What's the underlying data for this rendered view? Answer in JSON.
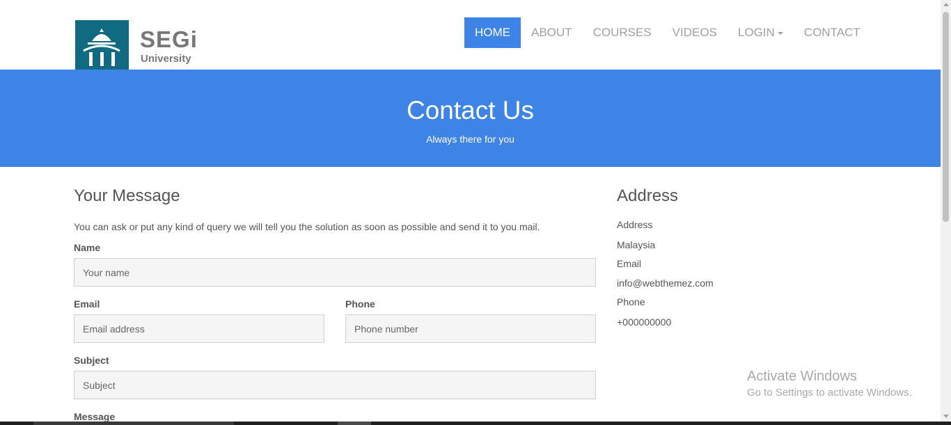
{
  "logo": {
    "title": "SEGi",
    "subtitle": "University"
  },
  "nav": {
    "home": "HOME",
    "about": "ABOUT",
    "courses": "COURSES",
    "videos": "VIDEOS",
    "login": "LOGIN",
    "contact": "CONTACT"
  },
  "banner": {
    "title": "Contact Us",
    "subtitle": "Always there for you"
  },
  "form": {
    "heading": "Your Message",
    "intro": "You can ask or put any kind of query we will tell you the solution as soon as possible and send it to you mail.",
    "name_label": "Name",
    "name_placeholder": "Your name",
    "email_label": "Email",
    "email_placeholder": "Email address",
    "phone_label": "Phone",
    "phone_placeholder": "Phone number",
    "subject_label": "Subject",
    "subject_placeholder": "Subject",
    "message_label": "Message"
  },
  "address": {
    "heading": "Address",
    "address_label": "Address",
    "address_value": "Malaysia",
    "email_label": "Email",
    "email_value": "info@webthemez.com",
    "phone_label": "Phone",
    "phone_value": "+000000000"
  },
  "watermark": {
    "line1": "Activate Windows",
    "line2": "Go to Settings to activate Windows."
  },
  "colors": {
    "brand_blue": "#3d84e6",
    "logo_teal": "#0f6a82"
  }
}
